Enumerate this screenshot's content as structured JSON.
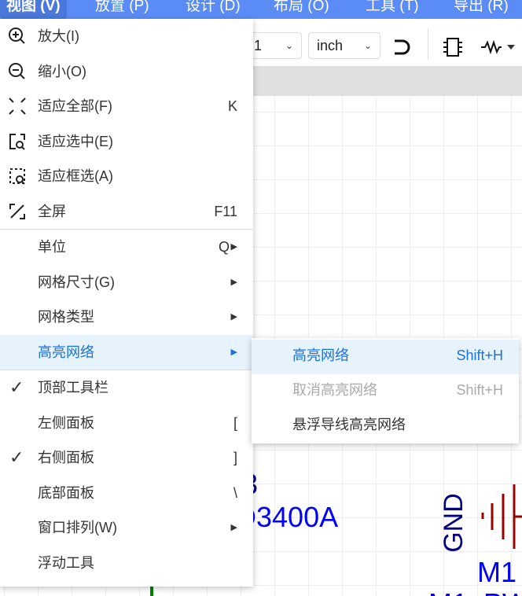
{
  "menubar": {
    "items": [
      "视图 (V)",
      "放置 (P)",
      "设计 (D)",
      "布局 (O)",
      "工具 (T)",
      "导出 (R)"
    ]
  },
  "toolbar": {
    "grid_value": "1",
    "unit_value": "inch"
  },
  "view_menu": {
    "items": [
      {
        "icon": "zoom-in-icon",
        "label": "放大(I)",
        "shortcut": ""
      },
      {
        "icon": "zoom-out-icon",
        "label": "缩小(O)",
        "shortcut": ""
      },
      {
        "icon": "fit-all-icon",
        "label": "适应全部(F)",
        "shortcut": "K"
      },
      {
        "icon": "fit-selected-icon",
        "label": "适应选中(E)",
        "shortcut": ""
      },
      {
        "icon": "fit-box-icon",
        "label": "适应框选(A)",
        "shortcut": ""
      },
      {
        "icon": "fullscreen-icon",
        "label": "全屏",
        "shortcut": "F11"
      },
      {
        "label": "单位",
        "shortcut": "Q",
        "submenu": true
      },
      {
        "label": "网格尺寸(G)",
        "submenu": true
      },
      {
        "label": "网格类型",
        "submenu": true
      },
      {
        "label": "高亮网络",
        "submenu": true,
        "highlighted": true
      },
      {
        "label": "顶部工具栏",
        "checked": true
      },
      {
        "label": "左侧面板",
        "shortcut": "["
      },
      {
        "label": "右侧面板",
        "shortcut": "]",
        "checked": true
      },
      {
        "label": "底部面板",
        "shortcut": "\\"
      },
      {
        "label": "窗口排列(W)",
        "submenu": true
      },
      {
        "label": "浮动工具"
      }
    ]
  },
  "highlight_submenu": {
    "items": [
      {
        "label": "高亮网络",
        "shortcut": "Shift+H",
        "state": "hover"
      },
      {
        "label": "取消高亮网络",
        "shortcut": "Shift+H",
        "state": "disabled"
      },
      {
        "label": "悬浮导线高亮网络",
        "shortcut": ""
      }
    ]
  },
  "canvas": {
    "designator_fragment": "3",
    "value_fragment": "D3400A",
    "net_label": "GND",
    "part_ref": "M1",
    "part_name_fragment": "M1_PW"
  },
  "colors": {
    "menubar": "#5b8cf5",
    "highlight_bg": "#e6f2fc",
    "highlight_text": "#1a73d9",
    "net_label": "#000080",
    "value_text": "#0000ff",
    "ground_symbol": "#990000"
  }
}
